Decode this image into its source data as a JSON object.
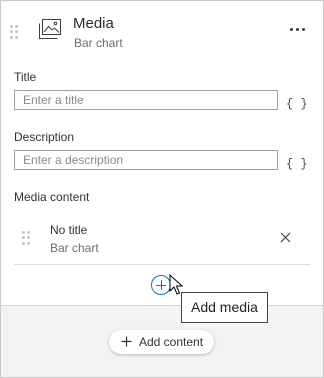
{
  "header": {
    "title": "Media",
    "subtitle": "Bar chart",
    "icon": "image-icon"
  },
  "title_field": {
    "label": "Title",
    "placeholder": "Enter a title",
    "value": "",
    "expression_button": "{ }"
  },
  "description_field": {
    "label": "Description",
    "placeholder": "Enter a description",
    "value": "",
    "expression_button": "{ }"
  },
  "media_content": {
    "label": "Media content",
    "items": [
      {
        "title": "No title",
        "subtitle": "Bar chart"
      }
    ],
    "add_tooltip": "Add media"
  },
  "footer": {
    "add_content_label": "Add content"
  },
  "colors": {
    "accent": "#0079c1",
    "text": "#323232",
    "muted_text": "#6e6e6e",
    "panel_background": "#f3f3f3"
  }
}
